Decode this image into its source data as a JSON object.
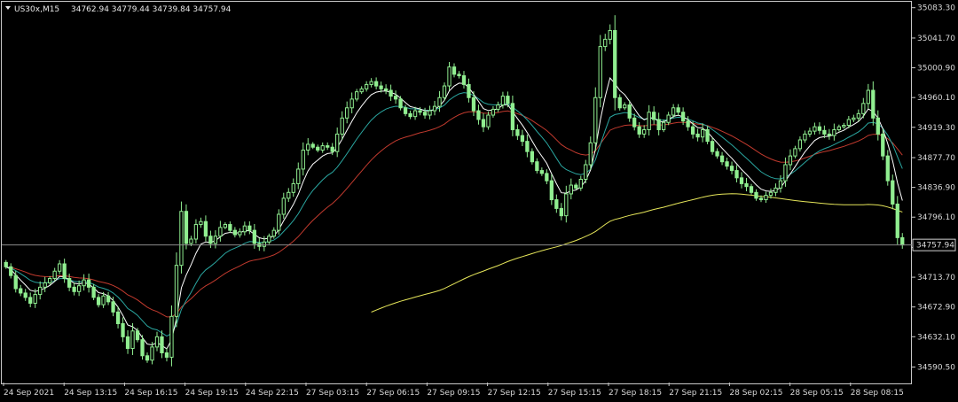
{
  "header": {
    "symbol": "US30x,M15",
    "ohlc": "34762.94 34779.44 34739.84 34757.94"
  },
  "current_price_label": "34757.94",
  "colors": {
    "background": "#000000",
    "frame": "#c8c8c8",
    "candle": "#90ee90",
    "ma_fast": "#ffffff",
    "ma_mid": "#2aa6a0",
    "ma_slow": "#c23a2e",
    "ma_long": "#e6e65a",
    "price_line": "#8c8c8c"
  },
  "chart_data": {
    "type": "candlestick",
    "ylim": [
      34569.3,
      35089.0
    ],
    "y_ticks": [
      35083.3,
      35041.7,
      35000.9,
      34960.1,
      34919.3,
      34877.7,
      34836.9,
      34796.1,
      34754.5,
      34713.7,
      34672.9,
      34632.1,
      34590.5
    ],
    "y_tick_labels": [
      "35083.30",
      "35041.70",
      "35000.90",
      "34960.10",
      "34919.30",
      "34877.70",
      "34836.90",
      "34796.10",
      "34754.50",
      "34713.70",
      "34672.90",
      "34632.10",
      "34590.50"
    ],
    "x_labels": [
      "24 Sep 2021",
      "24 Sep 13:15",
      "24 Sep 16:15",
      "24 Sep 19:15",
      "24 Sep 22:15",
      "27 Sep 03:15",
      "27 Sep 06:15",
      "27 Sep 09:15",
      "27 Sep 12:15",
      "27 Sep 15:15",
      "27 Sep 18:15",
      "27 Sep 21:15",
      "28 Sep 02:15",
      "28 Sep 05:15",
      "28 Sep 08:15"
    ],
    "current_price": 34757.94,
    "closes": [
      34728,
      34716,
      34698,
      34692,
      34686,
      34678,
      34690,
      34700,
      34706,
      34712,
      34722,
      34732,
      34712,
      34700,
      34694,
      34702,
      34710,
      34700,
      34686,
      34676,
      34688,
      34680,
      34666,
      34650,
      34632,
      34616,
      34640,
      34628,
      34606,
      34600,
      34618,
      34632,
      34610,
      34604,
      34660,
      34730,
      34804,
      34760,
      34766,
      34786,
      34790,
      34770,
      34760,
      34770,
      34782,
      34786,
      34778,
      34772,
      34776,
      34784,
      34778,
      34760,
      34756,
      34762,
      34770,
      34778,
      34800,
      34822,
      34830,
      34842,
      34862,
      34888,
      34896,
      34892,
      34888,
      34894,
      34892,
      34886,
      34910,
      34932,
      34946,
      34958,
      34968,
      34972,
      34978,
      34982,
      34976,
      34972,
      34970,
      34962,
      34958,
      34946,
      34938,
      34934,
      34942,
      34940,
      34936,
      34942,
      34948,
      34960,
      34976,
      35002,
      34992,
      34990,
      34978,
      34960,
      34942,
      34930,
      34920,
      34936,
      34944,
      34950,
      34962,
      34952,
      34916,
      34908,
      34900,
      34886,
      34872,
      34860,
      34856,
      34846,
      34820,
      34808,
      34798,
      34828,
      34840,
      34836,
      34848,
      34868,
      34898,
      34960,
      35030,
      35040,
      35052,
      34960,
      34946,
      34950,
      34932,
      34920,
      34910,
      34916,
      34940,
      34930,
      34916,
      34926,
      34936,
      34946,
      34940,
      34928,
      34920,
      34910,
      34906,
      34916,
      34900,
      34886,
      34880,
      34872,
      34866,
      34860,
      34850,
      34842,
      34838,
      34830,
      34822,
      34820,
      34826,
      34830,
      34836,
      34846,
      34868,
      34880,
      34890,
      34902,
      34910,
      34914,
      34920,
      34915,
      34910,
      34908,
      34916,
      34920,
      34922,
      34930,
      34932,
      34938,
      34952,
      34970,
      34932,
      34910,
      34880,
      34846,
      34814,
      34768,
      34758
    ]
  }
}
